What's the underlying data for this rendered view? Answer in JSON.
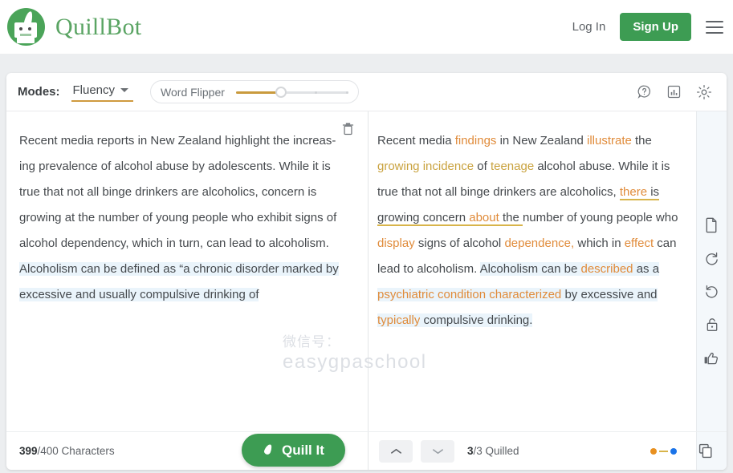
{
  "header": {
    "brand_name": "QuillBot",
    "logo_icon": "quillbot-robot-logo",
    "login_label": "Log In",
    "signup_label": "Sign Up",
    "menu_icon": "hamburger-menu-icon",
    "brand_color": "#5aa463",
    "signup_color": "#3d9c53"
  },
  "modes_bar": {
    "modes_label": "Modes:",
    "selected_mode": "Fluency",
    "caret_icon": "chevron-down-icon",
    "flipper_label": "Word Flipper",
    "slider_value_percent": 40,
    "slider_fill_color": "#c99a3d",
    "icons": [
      {
        "name": "help-icon",
        "label": "Help"
      },
      {
        "name": "statistics-icon",
        "label": "Statistics"
      },
      {
        "name": "settings-gear-icon",
        "label": "Settings"
      }
    ]
  },
  "left_pane": {
    "delete_icon": "trash-icon",
    "paragraph_plain": "Recent media reports in New Zealand highlight the increas-ing prevalence of alcohol abuse by adolescents. While it is true that not all binge drinkers are alcoholics, concern is growing at the number of young people who exhibit signs of alcohol dependency, which in turn, can lead to alcoholism. Alcoholism can be defined as “a chronic disorder marked by excessive and usually compulsive drinking of",
    "segments": [
      {
        "text": "Recent media reports in New Zealand highlight the increas-ing prevalence of alcohol abuse by adolescents. While it is true that not all binge drinkers are alcoholics, concern is growing at the number of young people who exhibit signs of alcohol dependency, which in turn, can lead to alcoholism. ",
        "style": "plain"
      },
      {
        "text": "Alcoholism can be defined as “a chronic disorder marked by excessive and usually compulsive drinking of",
        "style": "selected"
      }
    ],
    "footer": {
      "count_current": "399",
      "count_rest": "/400 Characters",
      "quill_button_label": "Quill It",
      "quill_button_icon": "feather-quill-icon"
    }
  },
  "right_pane": {
    "paragraph_plain": "Recent media findings in New Zealand illustrate the growing incidence of teenage alcohol abuse. While it is true that not all binge drinkers are alcoholics, there is growing concern about the number of young people who display signs of alcohol dependence, which in effect can lead to alcoholism. Alcoholism can be described as a psychiatric condition characterized by excessive and typically compulsive drinking.",
    "segments": [
      {
        "text": "Recent media ",
        "style": "plain"
      },
      {
        "text": "findings",
        "style": "orange"
      },
      {
        "text": " in New Zealand ",
        "style": "plain"
      },
      {
        "text": "illustrate",
        "style": "orange"
      },
      {
        "text": " the ",
        "style": "plain"
      },
      {
        "text": "growing incidence",
        "style": "gold"
      },
      {
        "text": " of ",
        "style": "plain"
      },
      {
        "text": "teenage",
        "style": "gold"
      },
      {
        "text": " alcohol abuse. While it is true that not all binge drinkers are alcoholics, ",
        "style": "plain"
      },
      {
        "text": "there",
        "style": "orange-underline"
      },
      {
        "text": " is growing concern ",
        "style": "underline"
      },
      {
        "text": "about",
        "style": "orange-underline"
      },
      {
        "text": " the ",
        "style": "underline"
      },
      {
        "text": "number of young people who ",
        "style": "plain"
      },
      {
        "text": "display",
        "style": "orange"
      },
      {
        "text": " signs of alcohol ",
        "style": "plain"
      },
      {
        "text": "dependence,",
        "style": "orange"
      },
      {
        "text": " which in ",
        "style": "plain"
      },
      {
        "text": "effect",
        "style": "orange"
      },
      {
        "text": " can lead to alcoholism. ",
        "style": "plain"
      },
      {
        "text": "Alcoholism can be ",
        "style": "selected"
      },
      {
        "text": "described",
        "style": "orange-selected"
      },
      {
        "text": " as a ",
        "style": "selected"
      },
      {
        "text": "psychiatric condition characterized",
        "style": "orange-selected"
      },
      {
        "text": " by excessive and ",
        "style": "selected"
      },
      {
        "text": "typically",
        "style": "orange-selected"
      },
      {
        "text": " compulsive drinking.",
        "style": "selected"
      }
    ],
    "rail_icons": [
      {
        "name": "document-icon",
        "label": "Document"
      },
      {
        "name": "redo-icon",
        "label": "Redo"
      },
      {
        "name": "undo-icon",
        "label": "Undo"
      },
      {
        "name": "lock-icon",
        "label": "Freeze words"
      },
      {
        "name": "thumbs-up-icon",
        "label": "Like"
      }
    ],
    "footer": {
      "up_icon": "chevron-up-icon",
      "down_icon": "chevron-down-icon",
      "quilled_current": "3",
      "quilled_rest": "/3 Quilled",
      "legend": [
        {
          "name": "word-change-dot",
          "color": "#e8901f"
        },
        {
          "name": "structure-change-dash",
          "color": "#d8b44a"
        },
        {
          "name": "no-change-dot",
          "color": "#1a73e8"
        }
      ],
      "copy_icon": "copy-icon"
    }
  },
  "watermark": {
    "line1": "微信号：",
    "line2": "easygpaschool"
  }
}
